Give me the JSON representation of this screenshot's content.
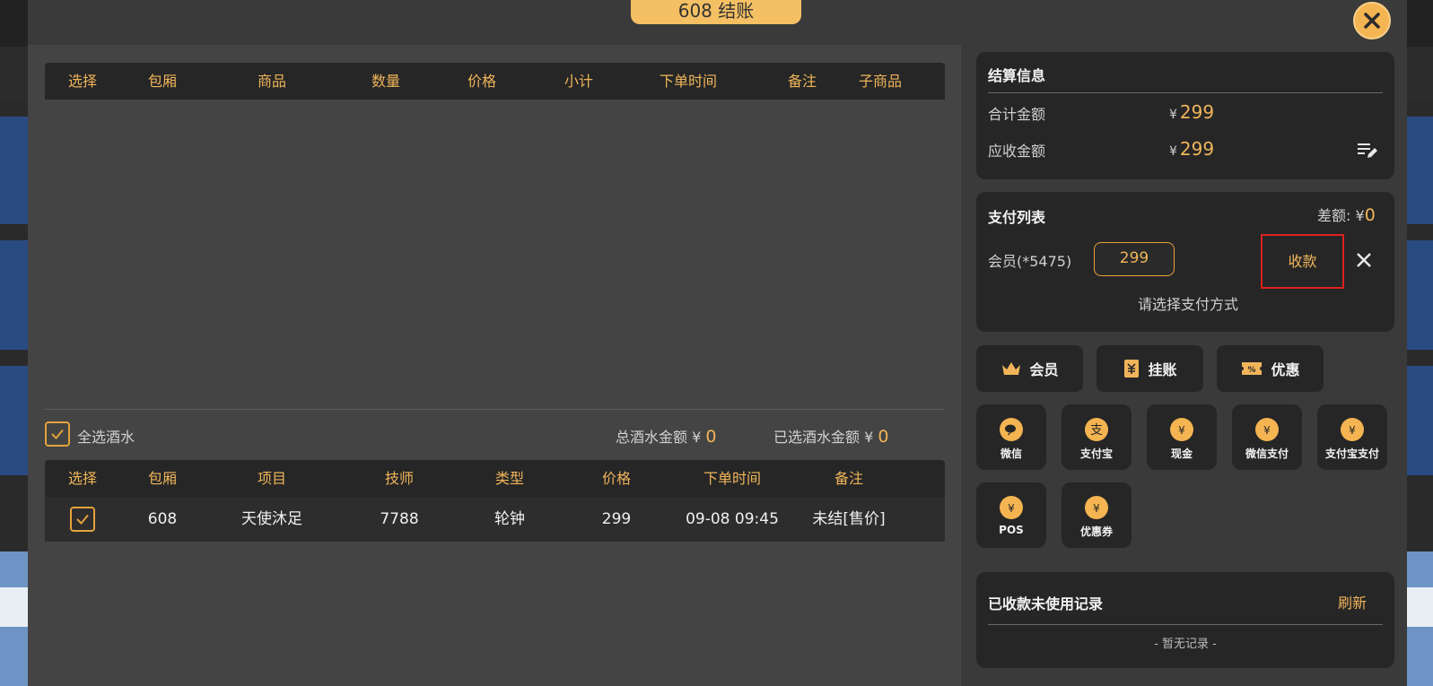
{
  "modal": {
    "title": "608 结账"
  },
  "goods_table": {
    "columns": [
      "选择",
      "包厢",
      "商品",
      "数量",
      "价格",
      "小计",
      "下单时间",
      "备注",
      "子商品"
    ],
    "rows": []
  },
  "drinks_summary": {
    "select_all_label": "全选酒水",
    "total_label": "总酒水金额",
    "total_currency": "¥",
    "total_value": "0",
    "selected_label": "已选酒水金额",
    "selected_currency": "¥",
    "selected_value": "0"
  },
  "service_table": {
    "columns": [
      "选择",
      "包厢",
      "项目",
      "技师",
      "类型",
      "价格",
      "下单时间",
      "备注"
    ],
    "rows": [
      {
        "checked": true,
        "room": "608",
        "item": "天使沐足",
        "tech": "7788",
        "type": "轮钟",
        "price": "299",
        "time": "09-08 09:45",
        "note": "未结[售价]"
      }
    ]
  },
  "settlement": {
    "title": "结算信息",
    "total_label": "合计金额",
    "total_currency": "¥",
    "total_value": "299",
    "receivable_label": "应收金额",
    "receivable_currency": "¥",
    "receivable_value": "299"
  },
  "payment_list": {
    "title": "支付列表",
    "diff_label": "差额:",
    "diff_currency": "¥",
    "diff_value": "0",
    "entries": [
      {
        "method": "会员(*5475)",
        "amount": "299",
        "action": "收款"
      }
    ],
    "hint": "请选择支付方式"
  },
  "quick_actions": [
    {
      "label": "会员",
      "icon": "crown-icon"
    },
    {
      "label": "挂账",
      "icon": "credit-ledger-icon"
    },
    {
      "label": "优惠",
      "icon": "discount-coupon-icon"
    }
  ],
  "pay_methods": [
    {
      "label": "微信",
      "icon": "wechat-icon"
    },
    {
      "label": "支付宝",
      "icon": "alipay-icon"
    },
    {
      "label": "现金",
      "icon": "money-bag-icon"
    },
    {
      "label": "微信支付",
      "icon": "money-bag-icon"
    },
    {
      "label": "支付宝支付",
      "icon": "money-bag-icon"
    },
    {
      "label": "POS",
      "icon": "money-bag-icon"
    },
    {
      "label": "优惠券",
      "icon": "money-bag-icon"
    }
  ],
  "records": {
    "title": "已收款未使用记录",
    "refresh_label": "刷新",
    "empty_text": "- 暂无记录 -"
  },
  "colors": {
    "accent": "#f0b55a",
    "highlight_border": "#e02020",
    "panel_dark": "#262626"
  }
}
